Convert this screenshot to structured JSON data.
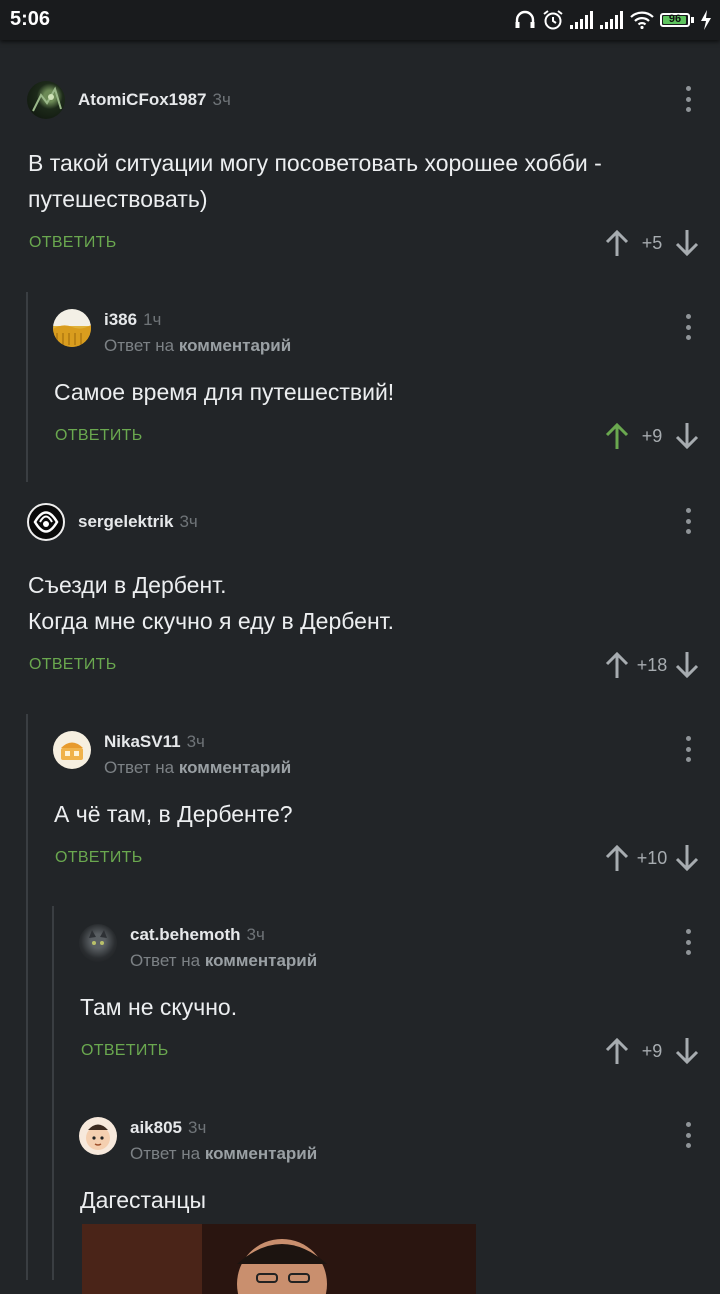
{
  "status_bar": {
    "time": "5:06",
    "icons": [
      "headphones-icon",
      "alarm-icon",
      "signal-icon",
      "signal-icon",
      "wifi-icon",
      "battery-icon",
      "charging-icon"
    ],
    "battery": "96",
    "battery_fraction": 0.96
  },
  "colors": {
    "background": "#222528",
    "reply_green": "#6aa84f",
    "upvoted_green": "#6aa84f",
    "thread_line": "#3a3e42"
  },
  "comments": [
    {
      "user": "AtomiCFox1987",
      "time": "3ч",
      "text_lines": [
        "В такой ситуации могу посоветовать хорошее хобби -",
        "путешествовать)"
      ],
      "reply_label": "ОТВЕТИТЬ",
      "score": "+5",
      "upvoted": false
    },
    {
      "user": "i386",
      "time": "1ч",
      "reply_prefix": "Ответ на",
      "reply_target": "комментарий",
      "text_lines": [
        "Самое время для путешествий!"
      ],
      "reply_label": "ОТВЕТИТЬ",
      "score": "+9",
      "upvoted": true
    },
    {
      "user": "sergelektrik",
      "time": "3ч",
      "text_lines": [
        "Съезди в Дербент.",
        "Когда мне скучно я еду в Дербент."
      ],
      "reply_label": "ОТВЕТИТЬ",
      "score": "+18",
      "upvoted": false
    },
    {
      "user": "NikaSV11",
      "time": "3ч",
      "reply_prefix": "Ответ на",
      "reply_target": "комментарий",
      "text_lines": [
        "А чё там, в Дербенте?"
      ],
      "reply_label": "ОТВЕТИТЬ",
      "score": "+10",
      "upvoted": false
    },
    {
      "user": "cat.behemoth",
      "time": "3ч",
      "reply_prefix": "Ответ на",
      "reply_target": "комментарий",
      "text_lines": [
        "Там не скучно."
      ],
      "reply_label": "ОТВЕТИТЬ",
      "score": "+9",
      "upvoted": false
    },
    {
      "user": "aik805",
      "time": "3ч",
      "reply_prefix": "Ответ на",
      "reply_target": "комментарий",
      "text_lines": [
        "Дагестанцы"
      ]
    }
  ]
}
